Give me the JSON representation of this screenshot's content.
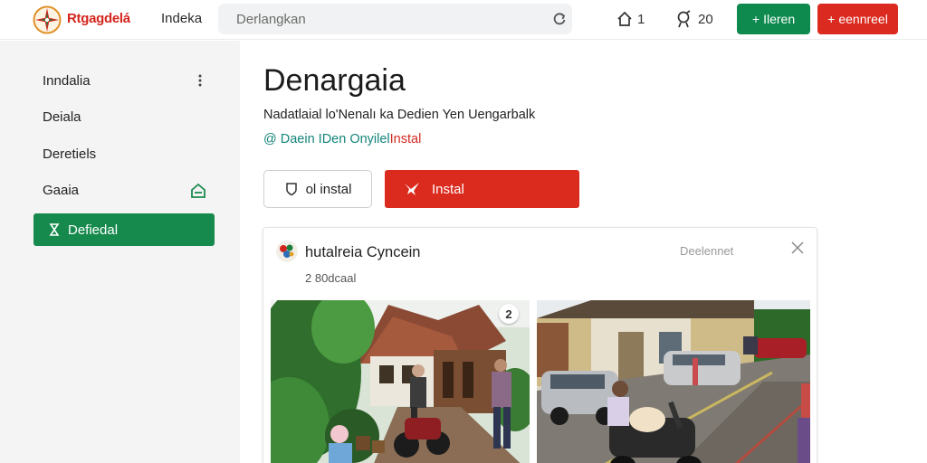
{
  "header": {
    "brand": "Rtgagdelá",
    "nav_link": "Indeka",
    "search_placeholder": "Derlangkan",
    "home_count": "1",
    "notif_count": "20",
    "green_button": "Ileren",
    "red_button": "eennreel"
  },
  "sidebar": {
    "items": [
      {
        "label": "Inndalia",
        "icon": "more-vertical-icon"
      },
      {
        "label": "Deiala"
      },
      {
        "label": "Deretiels"
      },
      {
        "label": "Gaaia",
        "icon": "dock-icon"
      },
      {
        "label": "Defiedal",
        "icon": "hourglass-icon",
        "active": true
      }
    ]
  },
  "main": {
    "title": "Denargaia",
    "subtitle": "Nadatlaial lo'Nenalı ka Dedien Yen Uengarbalk",
    "meta_part1": "@ Daein",
    "meta_part2": "IDen Onyilel",
    "meta_part3": "Instal",
    "buttons": {
      "secondary": "ol instal",
      "install": "Instal"
    }
  },
  "card": {
    "title": "hutalreia Cyncein",
    "subtitle": "2 80dcaal",
    "action": "Deelennet",
    "photo_badge": "2"
  },
  "colors": {
    "accent_green": "#0f8a4f",
    "accent_red": "#db2a1f",
    "link_teal": "#14857a"
  }
}
